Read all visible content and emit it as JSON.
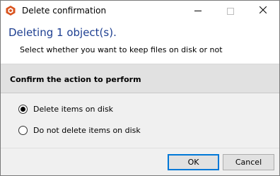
{
  "window": {
    "title": "Delete confirmation",
    "accent_color": "#1e3f91",
    "icon": "app-logo-icon"
  },
  "titlebar": {
    "minimize_icon": "minimize-icon",
    "maximize_icon": "maximize-icon",
    "close_icon": "close-icon"
  },
  "header": {
    "title": "Deleting 1 object(s).",
    "subtitle": "Select whether you want to keep files on disk or not"
  },
  "section": {
    "title": "Confirm the action to perform"
  },
  "options": [
    {
      "label": "Delete items on disk",
      "selected": true
    },
    {
      "label": "Do not delete items on disk",
      "selected": false
    }
  ],
  "footer": {
    "ok_label": "OK",
    "cancel_label": "Cancel"
  }
}
